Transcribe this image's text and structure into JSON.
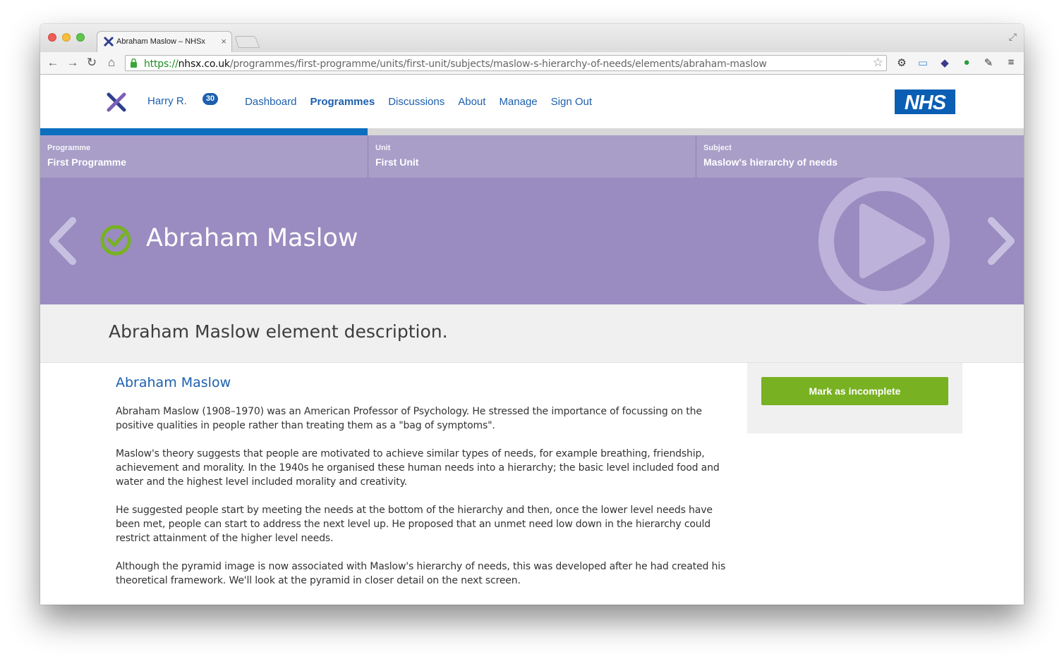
{
  "browser": {
    "tab_title": "Abraham Maslow – NHSx",
    "tab_close": "×",
    "url_scheme": "https://",
    "url_host": "nhsx.co.uk",
    "url_path": "/programmes/first-programme/units/first-unit/subjects/maslow-s-hierarchy-of-needs/elements/abraham-maslow",
    "icons": [
      "back-icon",
      "forward-icon",
      "reload-icon",
      "home-icon",
      "lock-icon",
      "star-icon",
      "settings-icon",
      "folder-icon",
      "extension-icon",
      "evernote-icon",
      "pin-icon",
      "menu-icon"
    ]
  },
  "header": {
    "user": "Harry R.",
    "badge": "30",
    "nav": [
      "Dashboard",
      "Programmes",
      "Discussions",
      "About",
      "Manage",
      "Sign Out"
    ],
    "active_nav": "Programmes",
    "logo_text": "NHS"
  },
  "progress": {
    "fraction": 0.333
  },
  "breadcrumbs": [
    {
      "label": "Programme",
      "value": "First Programme"
    },
    {
      "label": "Unit",
      "value": "First Unit"
    },
    {
      "label": "Subject",
      "value": "Maslow's hierarchy of needs"
    }
  ],
  "hero": {
    "title": "Abraham Maslow"
  },
  "description": "Abraham Maslow element description.",
  "content": {
    "title": "Abraham Maslow",
    "paragraphs": [
      "Abraham Maslow (1908–1970) was an American Professor of Psychology. He stressed the importance of focussing on the positive qualities in people rather than treating them as a \"bag of symptoms\".",
      "Maslow's theory suggests that people are motivated to achieve similar types of needs, for example breathing, friendship, achievement and morality. In the 1940s he organised these human needs into a hierarchy; the basic level included food and water and the highest level included morality and creativity.",
      "He suggested people start by meeting the needs at the bottom of the hierarchy and then, once the lower level needs have been met, people can start to address the next level up. He proposed that an unmet need low down in the hierarchy could restrict attainment of the higher level needs.",
      "Although the pyramid image is now associated with Maslow's hierarchy of needs, this was developed after he had created his theoretical framework. We'll look at the pyramid in closer detail on the next screen."
    ]
  },
  "sidebar": {
    "button_label": "Mark as incomplete"
  },
  "colors": {
    "accent": "#1d5fae",
    "hero": "#9a8cc0",
    "crumbs": "#a89ec8",
    "button": "#78b122",
    "progress": "#0c6ebf"
  }
}
